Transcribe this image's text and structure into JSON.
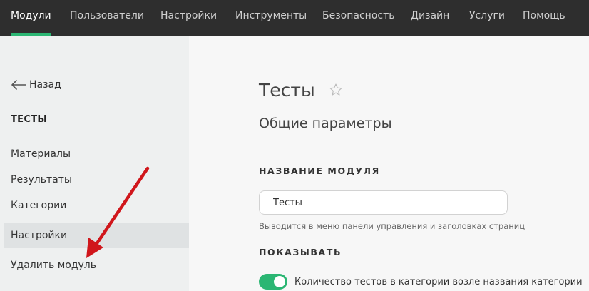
{
  "topnav": {
    "items": [
      {
        "label": "Модули",
        "active": true
      },
      {
        "label": "Пользователи"
      },
      {
        "label": "Настройки"
      },
      {
        "label": "Инструменты"
      },
      {
        "label": "Безопасность"
      },
      {
        "label": "Дизайн"
      },
      {
        "label": "Услуги"
      },
      {
        "label": "Помощь"
      }
    ]
  },
  "sidebar": {
    "back_label": "Назад",
    "section_title": "ТЕСТЫ",
    "items": [
      {
        "label": "Материалы"
      },
      {
        "label": "Результаты"
      },
      {
        "label": "Категории"
      },
      {
        "label": "Настройки",
        "active": true
      },
      {
        "label": "Удалить модуль"
      }
    ]
  },
  "main": {
    "title": "Тесты",
    "subtitle": "Общие параметры",
    "module_name_label": "НАЗВАНИЕ МОДУЛЯ",
    "module_name_value": "Тесты",
    "module_name_hint": "Выводится в меню панели управления и заголовках страниц",
    "show_label": "ПОКАЗЫВАТЬ",
    "toggle_label": "Количество тестов в категории возле названия категории",
    "toggle_on": true
  },
  "colors": {
    "accent": "#2bb673",
    "topbar_bg": "#2e2e2e",
    "annotation_arrow": "#d0161b"
  },
  "icons": {
    "back": "arrow-left-icon",
    "favorite": "star-outline-icon",
    "annotation": "red-arrow-annotation"
  }
}
